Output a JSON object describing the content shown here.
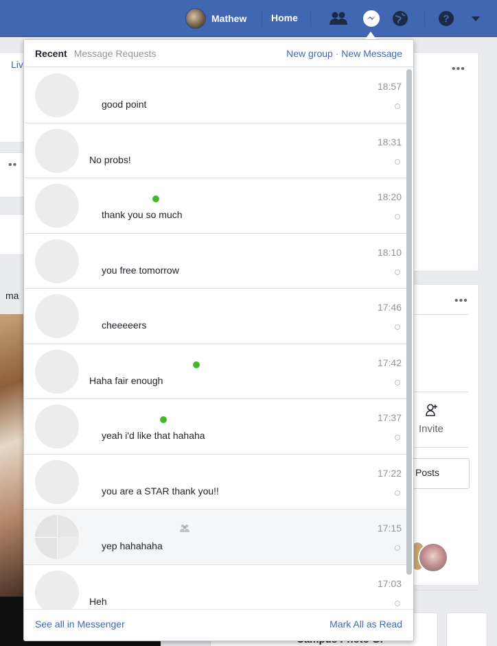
{
  "topbar": {
    "user_name": "Mathew",
    "home_label": "Home"
  },
  "background": {
    "left_text_1": "Liv",
    "left_text_2": "ma",
    "right_invite_label": "Invite",
    "right_posts_label": "Posts",
    "right_bottom_text": "Campus Photo Gr"
  },
  "messenger": {
    "tabs": [
      {
        "label": "Recent"
      },
      {
        "label": "Message Requests"
      }
    ],
    "new_group_label": "New group",
    "separator": " · ",
    "new_message_label": "New Message",
    "conversations": [
      {
        "snippet": "good point",
        "time": "18:57"
      },
      {
        "snippet": "No probs!",
        "time": "18:31"
      },
      {
        "snippet": "thank you so much",
        "time": "18:20"
      },
      {
        "snippet": "you free tomorrow",
        "time": "18:10"
      },
      {
        "snippet": "cheeeeers",
        "time": "17:46"
      },
      {
        "snippet": "Haha fair enough",
        "time": "17:42"
      },
      {
        "snippet": "yeah i'd like that hahaha",
        "time": "17:37"
      },
      {
        "snippet": "you are a STAR thank you!!",
        "time": "17:22"
      },
      {
        "snippet": "yep hahahaha",
        "time": "17:15"
      },
      {
        "snippet": "Heh",
        "time": "17:03"
      }
    ],
    "see_all_label": "See all in Messenger",
    "mark_all_read_label": "Mark All as Read"
  },
  "colors": {
    "brand_blue": "#4267b2",
    "active_green": "#42b72a"
  }
}
